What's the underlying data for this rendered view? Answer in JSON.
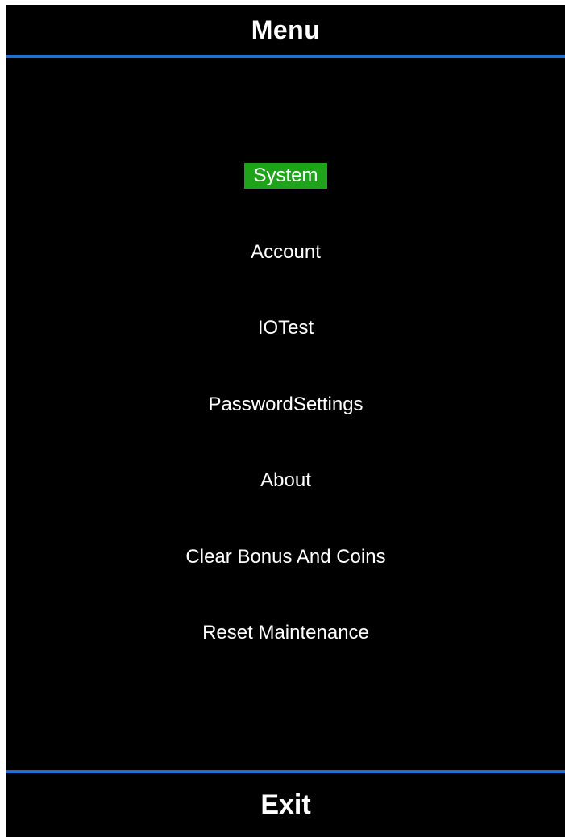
{
  "header": {
    "title": "Menu"
  },
  "menu": {
    "selected_index": 0,
    "selected_color": "#1fa31a",
    "divider_color": "#1d6fd8",
    "items": [
      {
        "label": "System"
      },
      {
        "label": "Account"
      },
      {
        "label": "IOTest"
      },
      {
        "label": "PasswordSettings"
      },
      {
        "label": "About"
      },
      {
        "label": "Clear Bonus And Coins"
      },
      {
        "label": "Reset Maintenance"
      }
    ]
  },
  "footer": {
    "exit_label": "Exit"
  }
}
